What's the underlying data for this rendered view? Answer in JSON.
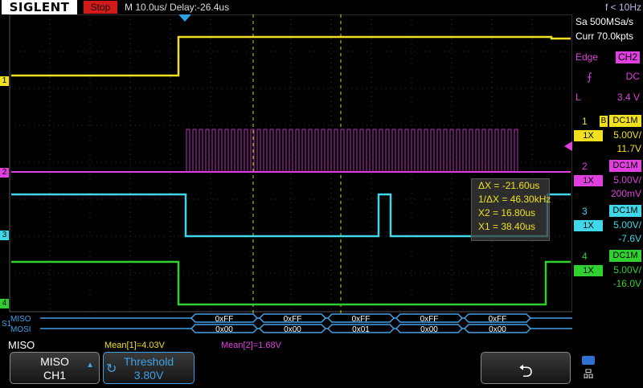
{
  "header": {
    "logo": "SIGLENT",
    "run_state": "Stop",
    "timebase": "M 10.0us/  Delay:-26.4us",
    "trigger_freq": "f < 10Hz"
  },
  "acquisition": {
    "sample_rate": "Sa 500MSa/s",
    "memory_depth": "Curr 70.0kpts"
  },
  "trigger": {
    "type": "Edge",
    "source": "CH2",
    "slope_icon": "rising-edge-icon",
    "coupling": "DC",
    "level_label": "L",
    "level": "3.4 V"
  },
  "channels": [
    {
      "num": "1",
      "bw": "B",
      "coupling": "DC1M",
      "probe": "1X",
      "scale": "5.00V/",
      "offset": "11.7V",
      "color": "#f0e020"
    },
    {
      "num": "2",
      "bw": "",
      "coupling": "DC1M",
      "probe": "1X",
      "scale": "5.00V/",
      "offset": "200mV",
      "color": "#e040e0"
    },
    {
      "num": "3",
      "bw": "",
      "coupling": "DC1M",
      "probe": "1X",
      "scale": "5.00V/",
      "offset": "-7.6V",
      "color": "#40d8e8"
    },
    {
      "num": "4",
      "bw": "",
      "coupling": "DC1M",
      "probe": "1X",
      "scale": "5.00V/",
      "offset": "-16.0V",
      "color": "#30d030"
    }
  ],
  "channel_markers": [
    "1",
    "2",
    "3",
    "4"
  ],
  "cursors": {
    "delta_x": "ΔX = -21.60us",
    "inv_delta_x": "1/ΔX = 46.30kHz",
    "x2": "X2 = 16.80us",
    "x1": "X1 = 38.40us"
  },
  "decode": {
    "bus_marker": "S1",
    "miso_label": "MISO",
    "mosi_label": "MOSI",
    "miso_values": [
      "0xFF",
      "0xFF",
      "0xFF",
      "0xFF",
      "0xFF"
    ],
    "mosi_values": [
      "0x00",
      "0x00",
      "0x01",
      "0x00",
      "0x00"
    ]
  },
  "measurements": {
    "mean1": "Mean[1]=4.03V",
    "mean2": "Mean[2]=1.68V"
  },
  "menu": {
    "title": "MISO",
    "source_label": "MISO",
    "source_value": "CH1",
    "threshold_label": "Threshold",
    "threshold_value": "3.80V",
    "back_icon": "return-arrow-icon",
    "status_icons": [
      "usb-icon",
      "network-icon"
    ]
  }
}
